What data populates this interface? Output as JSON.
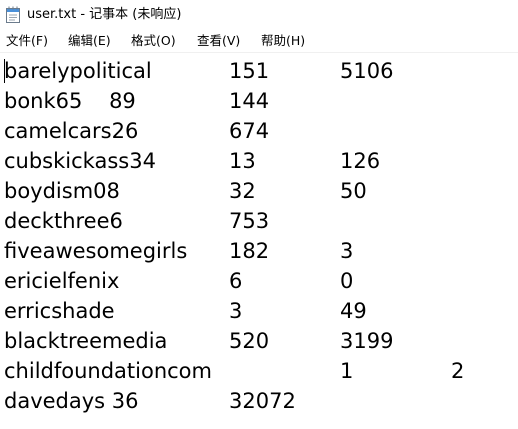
{
  "window": {
    "title": "user.txt - 记事本 (未响应)"
  },
  "menu": {
    "file": "文件(F)",
    "edit": "编辑(E)",
    "format": "格式(O)",
    "view": "查看(V)",
    "help": "帮助(H)"
  },
  "lines": [
    {
      "name": "barelypolitical",
      "c2": "151",
      "c3": "5106",
      "c4": ""
    },
    {
      "name": "bonk65    89",
      "c2": "144",
      "c3": "",
      "c4": ""
    },
    {
      "name": "camelcars26",
      "c2": "674",
      "c3": "",
      "c4": ""
    },
    {
      "name": "cubskickass34",
      "c2": "13",
      "c3": "126",
      "c4": ""
    },
    {
      "name": "boydism08",
      "c2": "32",
      "c3": "50",
      "c4": ""
    },
    {
      "name": "deckthree6",
      "c2": "753",
      "c3": "",
      "c4": ""
    },
    {
      "name": "fiveawesomegirls",
      "c2": "182",
      "c3": "3",
      "c4": ""
    },
    {
      "name": "ericielfenix",
      "c2": "6",
      "c3": "0",
      "c4": ""
    },
    {
      "name": "erricshade",
      "c2": "3",
      "c3": "49",
      "c4": ""
    },
    {
      "name": "blacktreemedia",
      "c2": "520",
      "c3": "3199",
      "c4": ""
    },
    {
      "name": "childfoundationcom",
      "c2": "",
      "c3": "1",
      "c4": "2"
    },
    {
      "name": "davedays 36",
      "c2": "32072",
      "c3": "",
      "c4": ""
    }
  ]
}
